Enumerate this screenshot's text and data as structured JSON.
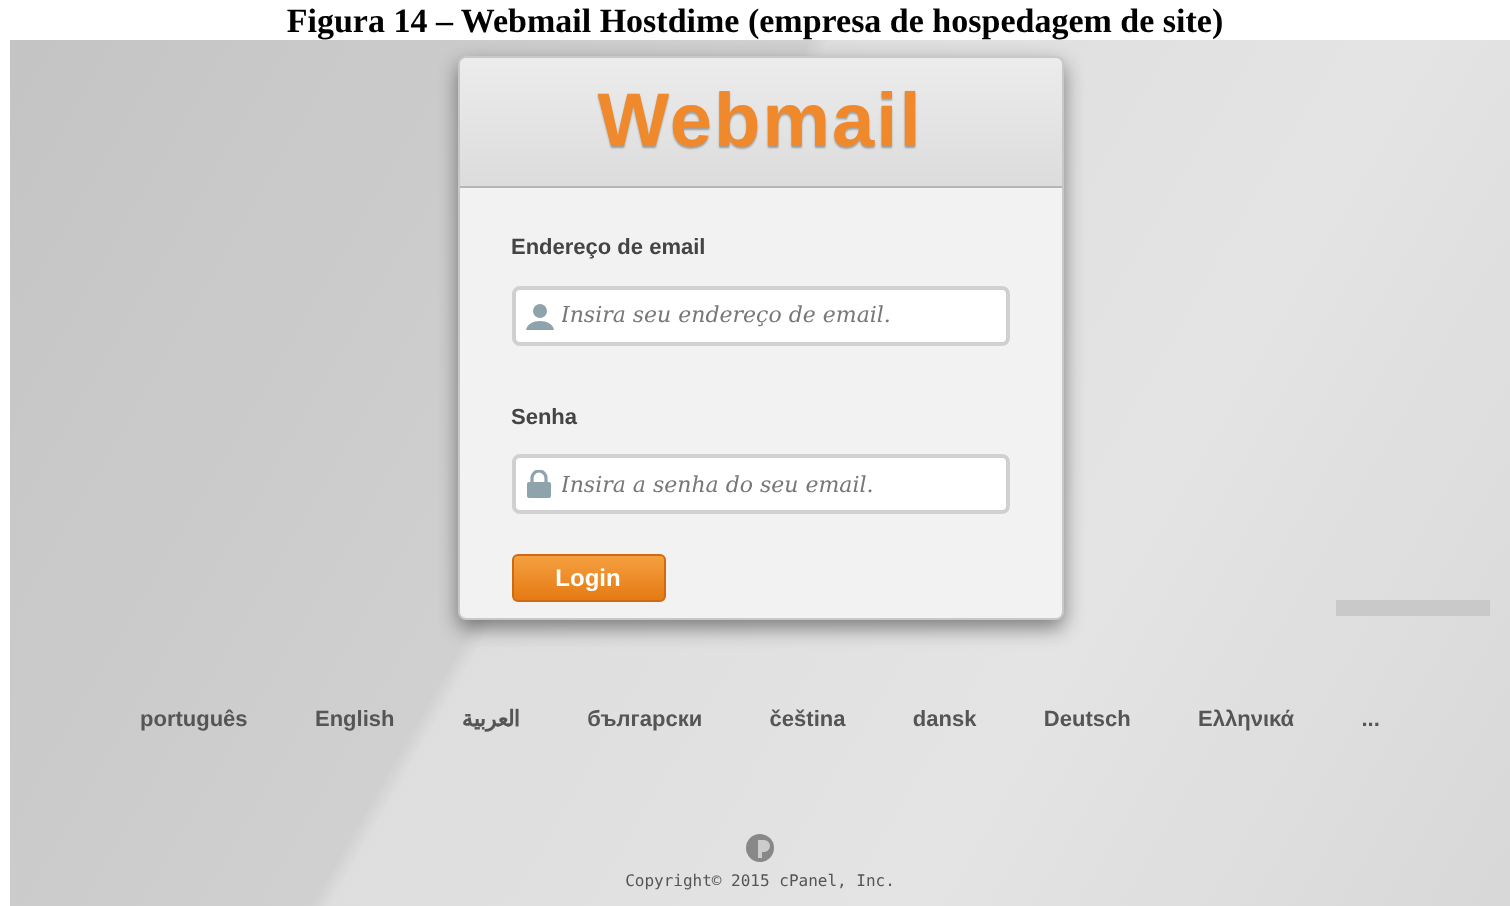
{
  "caption": "Figura 14 – Webmail Hostdime (empresa de hospedagem de site)",
  "login": {
    "logo": "Webmail",
    "email": {
      "label": "Endereço de email",
      "placeholder": "Insira seu endereço de email."
    },
    "password": {
      "label": "Senha",
      "placeholder": "Insira a senha do seu email."
    },
    "button": "Login"
  },
  "languages": [
    "português",
    "English",
    "العربية",
    "български",
    "čeština",
    "dansk",
    "Deutsch",
    "Ελληνικά",
    "..."
  ],
  "copyright": "Copyright© 2015 cPanel, Inc."
}
